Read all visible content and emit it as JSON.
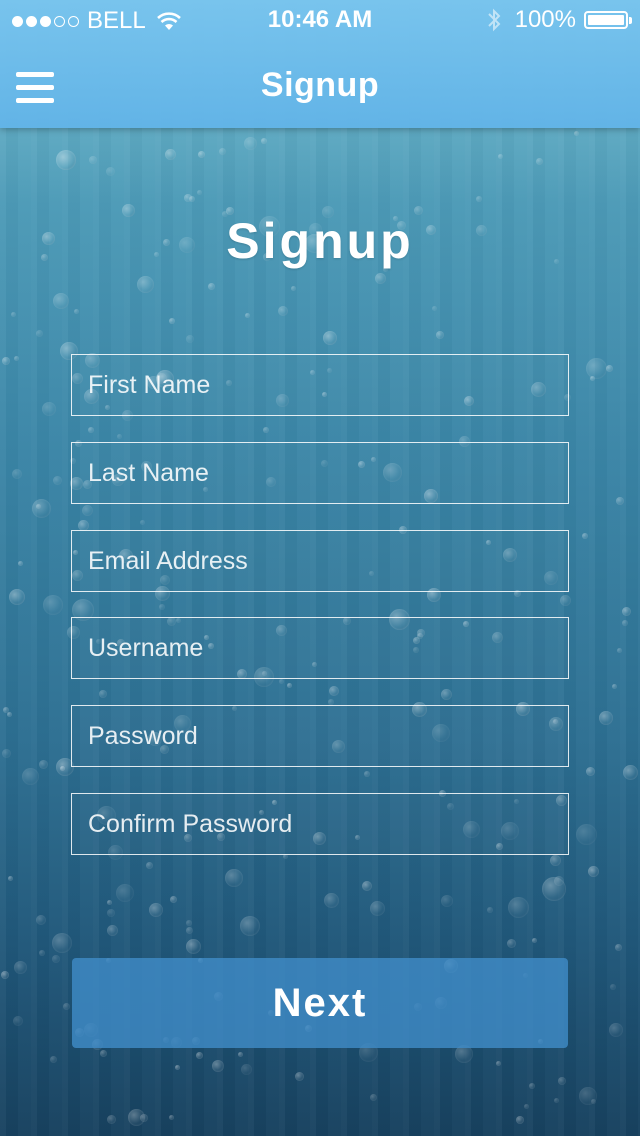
{
  "status_bar": {
    "carrier": "BELL",
    "time": "10:46 AM",
    "battery": "100%",
    "signal_bars_filled": 3,
    "signal_bars_total": 5
  },
  "nav": {
    "title": "Signup",
    "menu_icon": "hamburger-menu-icon"
  },
  "page": {
    "heading": "Signup"
  },
  "form": {
    "first_name_placeholder": "First Name",
    "last_name_placeholder": "Last Name",
    "email_placeholder": "Email Address",
    "username_placeholder": "Username",
    "password_placeholder": "Password",
    "confirm_password_placeholder": "Confirm Password",
    "next_label": "Next"
  },
  "colors": {
    "nav_bar": "#6fbbe9",
    "button": "#3f88c5",
    "text": "#ffffff"
  }
}
